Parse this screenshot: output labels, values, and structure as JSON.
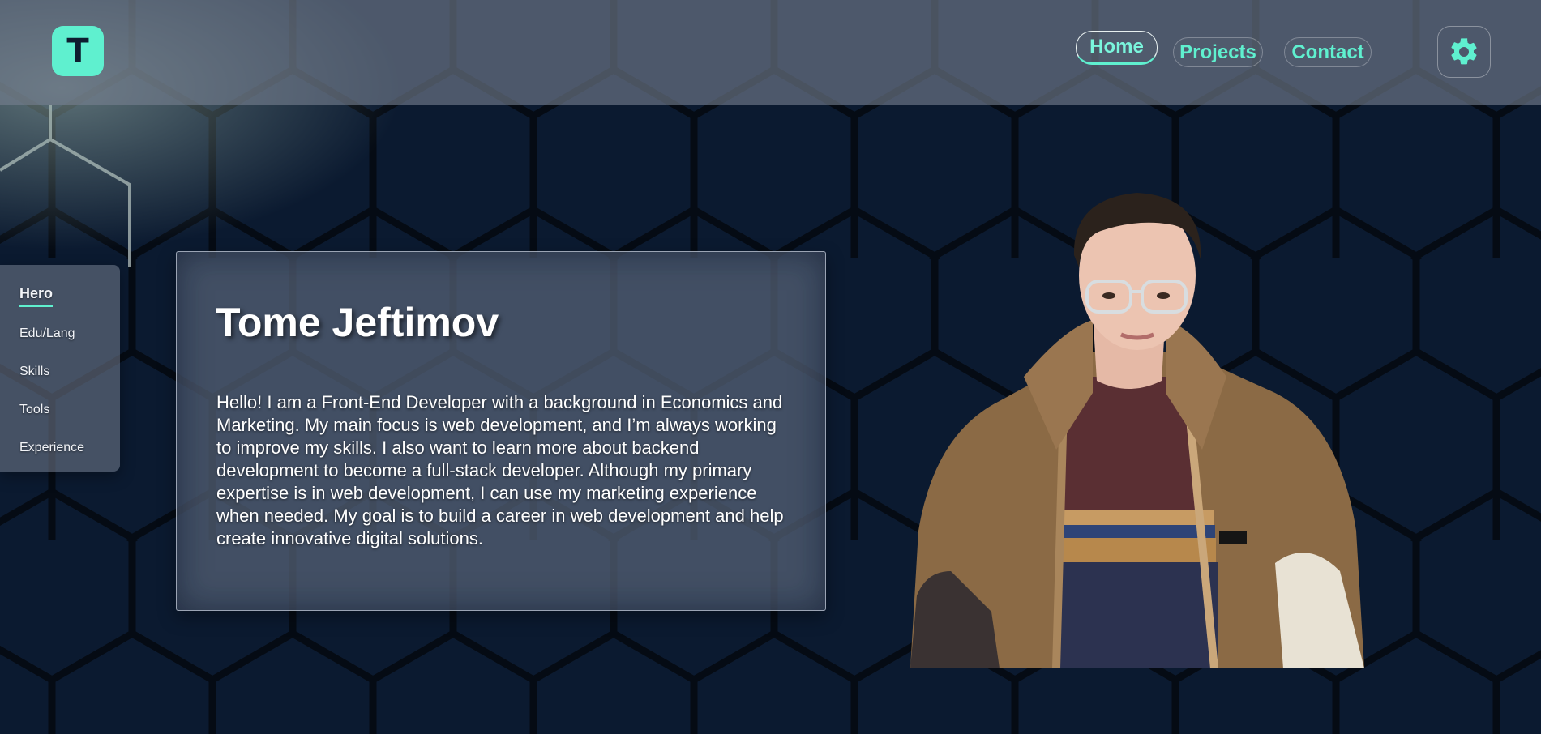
{
  "header": {
    "logo_letter": "T",
    "nav": [
      {
        "label": "Home",
        "active": true
      },
      {
        "label": "Projects",
        "active": false
      },
      {
        "label": "Contact",
        "active": false
      }
    ],
    "settings_icon": "gear-icon"
  },
  "sidenav": {
    "items": [
      {
        "label": "Hero",
        "active": true
      },
      {
        "label": "Edu/Lang",
        "active": false
      },
      {
        "label": "Skills",
        "active": false
      },
      {
        "label": "Tools",
        "active": false
      },
      {
        "label": "Experience",
        "active": false
      }
    ]
  },
  "hero": {
    "name": "Tome Jeftimov",
    "bio": "Hello! I am a Front-End Developer with a background in Economics and Marketing. My main focus is web development, and I’m always working to improve my skills. I also want to learn more about backend development to become a full-stack developer. Although my primary expertise is in web development, I can use my marketing experience when needed. My goal is to build a career in web development and help create innovative digital solutions."
  },
  "colors": {
    "accent": "#5ff0cf",
    "background": "#0b1a30",
    "glass": "#768090"
  }
}
